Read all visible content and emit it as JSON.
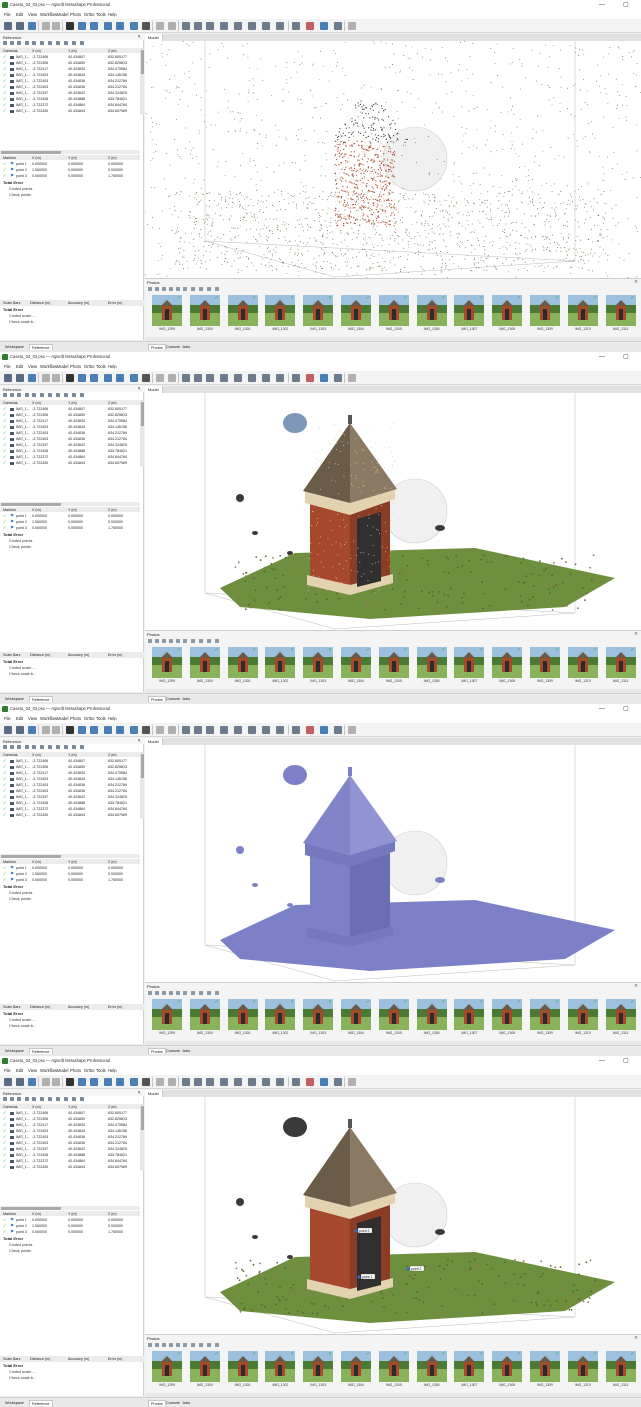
{
  "window": {
    "title": "Caseta_03_02.psx — Agisoft Metashape Professional",
    "minimize_glyph": "—",
    "maximize_glyph": "▢"
  },
  "menu": [
    "File",
    "Edit",
    "View",
    "Workflow",
    "Model",
    "Photo",
    "Ortho",
    "Tools",
    "Help"
  ],
  "reference_panel": {
    "title": "Reference",
    "close_glyph": "✕",
    "cameras_header": [
      "Cameras",
      "X (m)",
      "Y (m)",
      "Z (m)"
    ],
    "cameras": [
      {
        "label": "IMG_1...",
        "x": "-3.722406",
        "y": "40.434807",
        "z": "632.600177"
      },
      {
        "label": "IMG_1...",
        "x": "-3.722406",
        "y": "40.434850",
        "z": "632.825813"
      },
      {
        "label": "IMG_1...",
        "x": "-3.722417",
        "y": "40.434830",
        "z": "634.075584"
      },
      {
        "label": "IMG_1...",
        "x": "-3.722403",
        "y": "40.434844",
        "z": "634.146156"
      },
      {
        "label": "IMG_1...",
        "x": "-3.722403",
        "y": "40.434836",
        "z": "634.212784"
      },
      {
        "label": "IMG_1...",
        "x": "-3.722403",
        "y": "40.434836",
        "z": "634.212784"
      },
      {
        "label": "IMG_1...",
        "x": "-3.722397",
        "y": "40.434842",
        "z": "634.324829"
      },
      {
        "label": "IMG_1...",
        "x": "-3.722408",
        "y": "40.434888",
        "z": "634.784621"
      },
      {
        "label": "IMG_1...",
        "x": "-3.722372",
        "y": "40.434864",
        "z": "634.844784"
      },
      {
        "label": "IMG_1...",
        "x": "-3.722400",
        "y": "40.434844",
        "z": "634.607969"
      }
    ],
    "markers_header": [
      "Markers",
      "X (m)",
      "Y (m)",
      "Z (m)"
    ],
    "markers": [
      {
        "label": "point 1",
        "x": "0.000000",
        "y": "0.000000",
        "z": "0.000000"
      },
      {
        "label": "point 2",
        "x": "1.550000",
        "y": "0.000000",
        "z": "0.000000"
      },
      {
        "label": "point 3",
        "x": "0.000000",
        "y": "0.000000",
        "z": "1.750000"
      }
    ],
    "total_error": "Total Error",
    "control_points": "Control points",
    "check_points": "Check points",
    "scalebars_header": [
      "Scale Bars",
      "Distance (m)",
      "Accuracy (m)",
      "Error (m)"
    ],
    "control_scale": "Control scale ...",
    "check_scale": "Check scale b..."
  },
  "left_tabs": [
    "Workspace",
    "Reference"
  ],
  "model_tab": "Model",
  "photos_panel": {
    "title": "Photos",
    "photos": [
      "IMG_1299",
      "IMG_1300",
      "IMG_1301",
      "IMG_1302",
      "IMG_1303",
      "IMG_1304",
      "IMG_1305",
      "IMG_1306",
      "IMG_1307",
      "IMG_1308",
      "IMG_1309",
      "IMG_1310",
      "IMG_1311"
    ]
  },
  "bottom_tabs": [
    "Photos",
    "Console",
    "Jobs"
  ],
  "views": [
    {
      "mode": "sparse-point-cloud"
    },
    {
      "mode": "dense-point-cloud"
    },
    {
      "mode": "solid-mesh"
    },
    {
      "mode": "textured-mesh-with-markers",
      "marker_labels": [
        "point 3",
        "point 1",
        "point 2"
      ]
    }
  ],
  "colors": {
    "brick": "#a6482c",
    "roof": "#6b5c4a",
    "mesh": "#7c80c6",
    "grass": "#6e8f3e",
    "check": "#2e9e44",
    "marker_flag": "#2d6fd6"
  }
}
